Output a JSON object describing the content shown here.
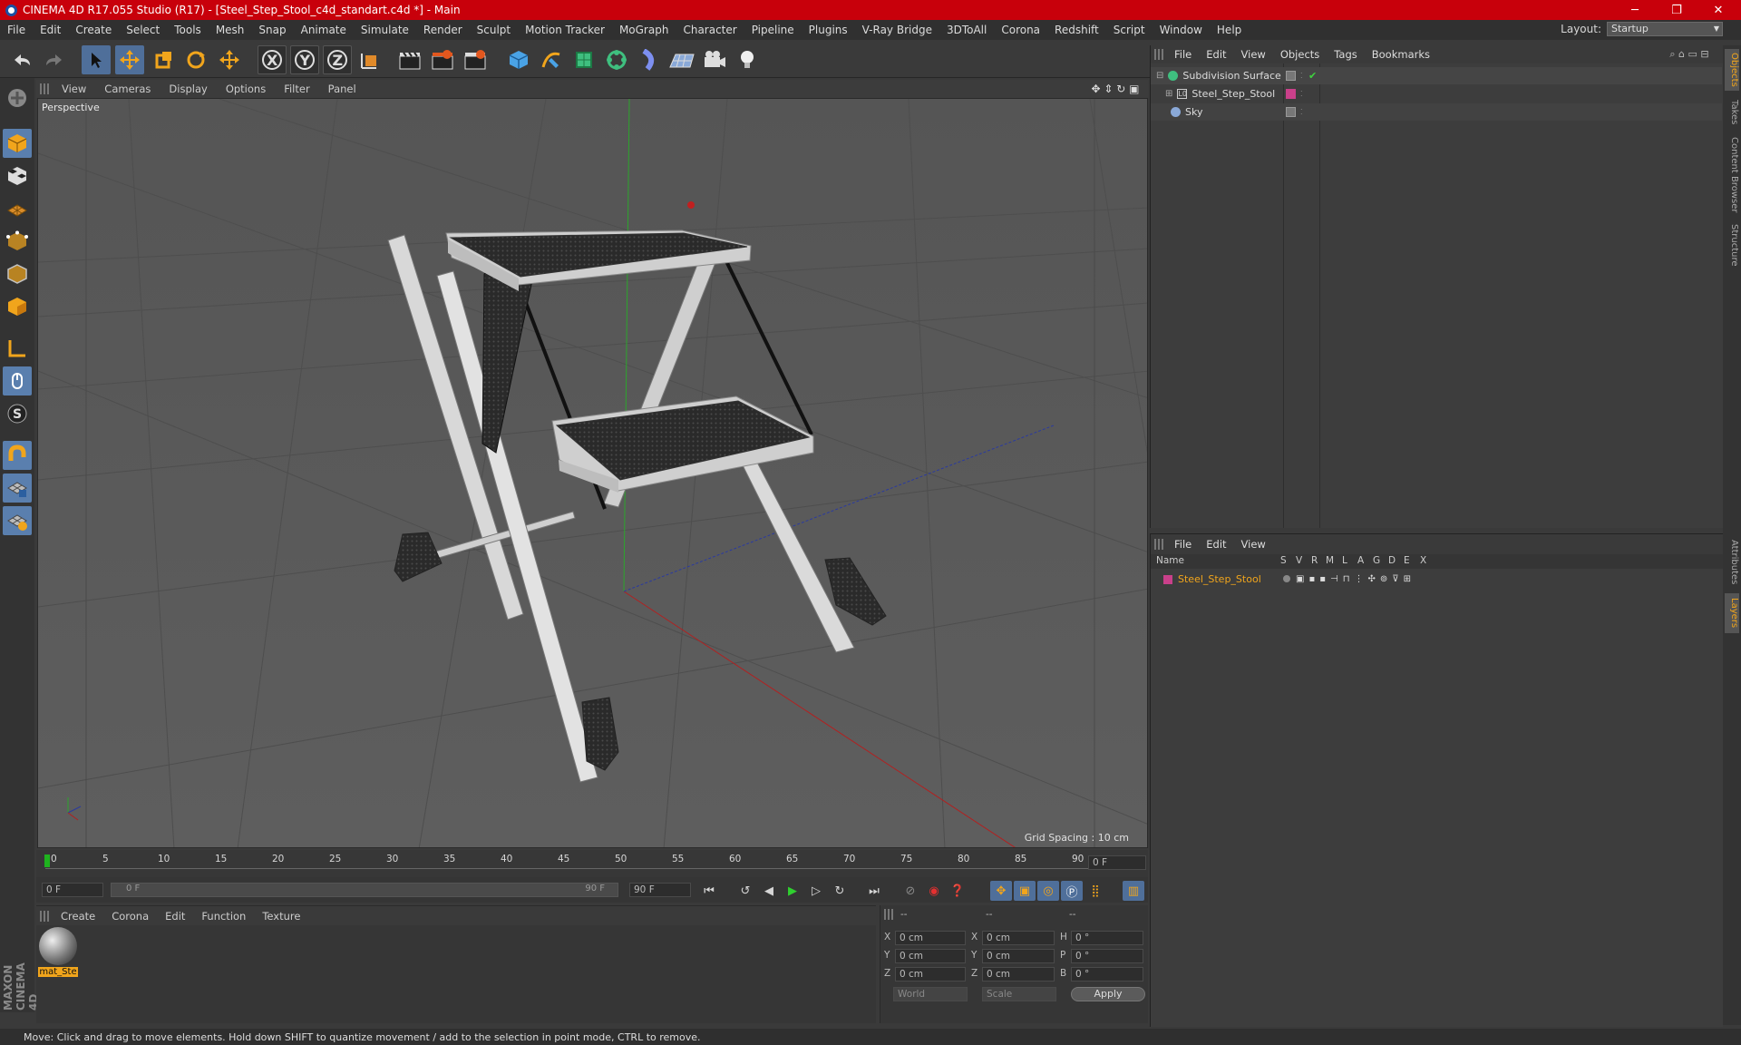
{
  "window": {
    "title": "CINEMA 4D R17.055 Studio (R17) - [Steel_Step_Stool_c4d_standart.c4d *] - Main",
    "minimize": "─",
    "maximize": "❐",
    "close": "✕"
  },
  "menu": [
    "File",
    "Edit",
    "Create",
    "Select",
    "Tools",
    "Mesh",
    "Snap",
    "Animate",
    "Simulate",
    "Render",
    "Sculpt",
    "Motion Tracker",
    "MoGraph",
    "Character",
    "Pipeline",
    "Plugins",
    "V-Ray Bridge",
    "3DToAll",
    "Corona",
    "Redshift",
    "Script",
    "Window",
    "Help"
  ],
  "layout": {
    "label": "Layout:",
    "value": "Startup"
  },
  "viewport": {
    "menu": [
      "View",
      "Cameras",
      "Display",
      "Options",
      "Filter",
      "Panel"
    ],
    "label": "Perspective",
    "grid_spacing": "Grid Spacing : 10 cm"
  },
  "timeline": {
    "ticks": [
      "0",
      "5",
      "10",
      "15",
      "20",
      "25",
      "30",
      "35",
      "40",
      "45",
      "50",
      "55",
      "60",
      "65",
      "70",
      "75",
      "80",
      "85",
      "90"
    ],
    "current_frame": "0 F",
    "start": "0 F",
    "range_start": "0 F",
    "range_end": "90 F",
    "end": "90 F"
  },
  "material_manager": {
    "menu": [
      "Create",
      "Corona",
      "Edit",
      "Function",
      "Texture"
    ],
    "materials": [
      {
        "name": "mat_Ste"
      }
    ]
  },
  "coordinates": {
    "header": [
      "--",
      "--",
      "--"
    ],
    "rows": [
      {
        "a": "X",
        "av": "0 cm",
        "b": "X",
        "bv": "0 cm",
        "c": "H",
        "cv": "0 °"
      },
      {
        "a": "Y",
        "av": "0 cm",
        "b": "Y",
        "bv": "0 cm",
        "c": "P",
        "cv": "0 °"
      },
      {
        "a": "Z",
        "av": "0 cm",
        "b": "Z",
        "bv": "0 cm",
        "c": "B",
        "cv": "0 °"
      }
    ],
    "mode1": "World",
    "mode2": "Scale",
    "apply": "Apply"
  },
  "object_manager": {
    "menu": [
      "File",
      "Edit",
      "View",
      "Objects",
      "Tags",
      "Bookmarks"
    ],
    "objects": [
      {
        "name": "Subdivision Surface",
        "color": "#3fbf7f"
      },
      {
        "name": "Steel_Step_Stool",
        "color": "#c0c0c0"
      },
      {
        "name": "Sky",
        "color": "#8aa9d8"
      }
    ]
  },
  "layer_manager": {
    "menu": [
      "File",
      "Edit",
      "View"
    ],
    "columns": [
      "Name",
      "S",
      "V",
      "R",
      "M",
      "L",
      "A",
      "G",
      "D",
      "E",
      "X"
    ],
    "layers": [
      {
        "name": "Steel_Step_Stool",
        "color": "#c9408a"
      }
    ]
  },
  "side_tabs": [
    "Objects",
    "Takes",
    "Content Browser",
    "Structure",
    "Attributes",
    "Layers"
  ],
  "brand": "MAXON CINEMA 4D",
  "status": "Move: Click and drag to move elements. Hold down SHIFT to quantize movement / add to the selection in point mode, CTRL to remove."
}
